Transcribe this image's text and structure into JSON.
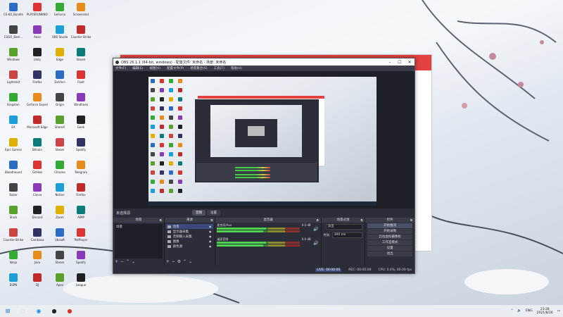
{
  "desktop": {
    "icons": [
      "CS-Kit_Bundle",
      "PLAYERUNKNOWN",
      "GeForce",
      "Screenshot",
      "CSGO_Bam...",
      "Aeon",
      "OBS Studio",
      "Counter-Strike",
      "Windows",
      "Unity",
      "Edge",
      "Steam",
      "Lightshot",
      "Firefox",
      "DaVinci",
      "Foxit",
      "Kingston",
      "GeForce Experience",
      "Origin",
      "Windhoek",
      "EA",
      "Microsoft Edge",
      "ShareX",
      "Geek",
      "Epic Games",
      "Bitcoin",
      "Steam",
      "Spotify",
      "Bloodhound",
      "GitHub",
      "Chrome",
      "Telegram",
      "Razer",
      "Canva",
      "Notion",
      "Firefox",
      "Slack",
      "Discord",
      "Zoom",
      "AIMP",
      "Counter-Strike",
      "Camtasia",
      "Ubisoft",
      "PotPlayer",
      "Ninja",
      "Java",
      "Steam",
      "Spotify",
      "ESPN",
      "DJ",
      "Apex",
      "League"
    ]
  },
  "obs": {
    "title": "OBS 26.1.1 (64-bit, windows) - 配置文件: 未命名 - 场景: 未命名",
    "window_controls": [
      "–",
      "☐",
      "✕"
    ],
    "menu": [
      "文件(F)",
      "编辑(E)",
      "视图(V)",
      "配置文件(P)",
      "场景集合(S)",
      "工具(T)",
      "帮助(H)"
    ],
    "no_source": "未选择源",
    "modes": [
      "音频",
      "设置"
    ],
    "docks": {
      "scenes": {
        "title": "场景",
        "items": [
          "场景"
        ]
      },
      "sources": {
        "title": "来源",
        "items": [
          "场景",
          "显示器采集",
          "音频输入采集",
          "图像",
          "颜色源"
        ]
      },
      "mixer": {
        "title": "混音器",
        "channels": [
          {
            "name": "麦克风/Aux",
            "db": "0.0 dB"
          },
          {
            "name": "桌面音频",
            "db": "0.0 dB"
          }
        ]
      },
      "transitions": {
        "title": "场景过渡",
        "type_label": "淡出",
        "duration_label": "时长",
        "duration": "300 ms"
      },
      "controls": {
        "title": "控件",
        "buttons": [
          "开始推流",
          "开始录制",
          "启动虚拟摄像机",
          "工作室模式",
          "设置",
          "退出"
        ]
      }
    },
    "status": {
      "live": "LIVE: 00:00:00",
      "rec": "REC: 00:00:00",
      "cpu": "CPU: 0.4%, 60.00 fps"
    }
  },
  "taskbar": {
    "lang": "ENG",
    "time": "23:28",
    "date": "2021/8/26"
  },
  "colors": {
    "obs_bg": "#2b2e38",
    "accent": "#e44141",
    "selection": "#3b4a7a"
  }
}
